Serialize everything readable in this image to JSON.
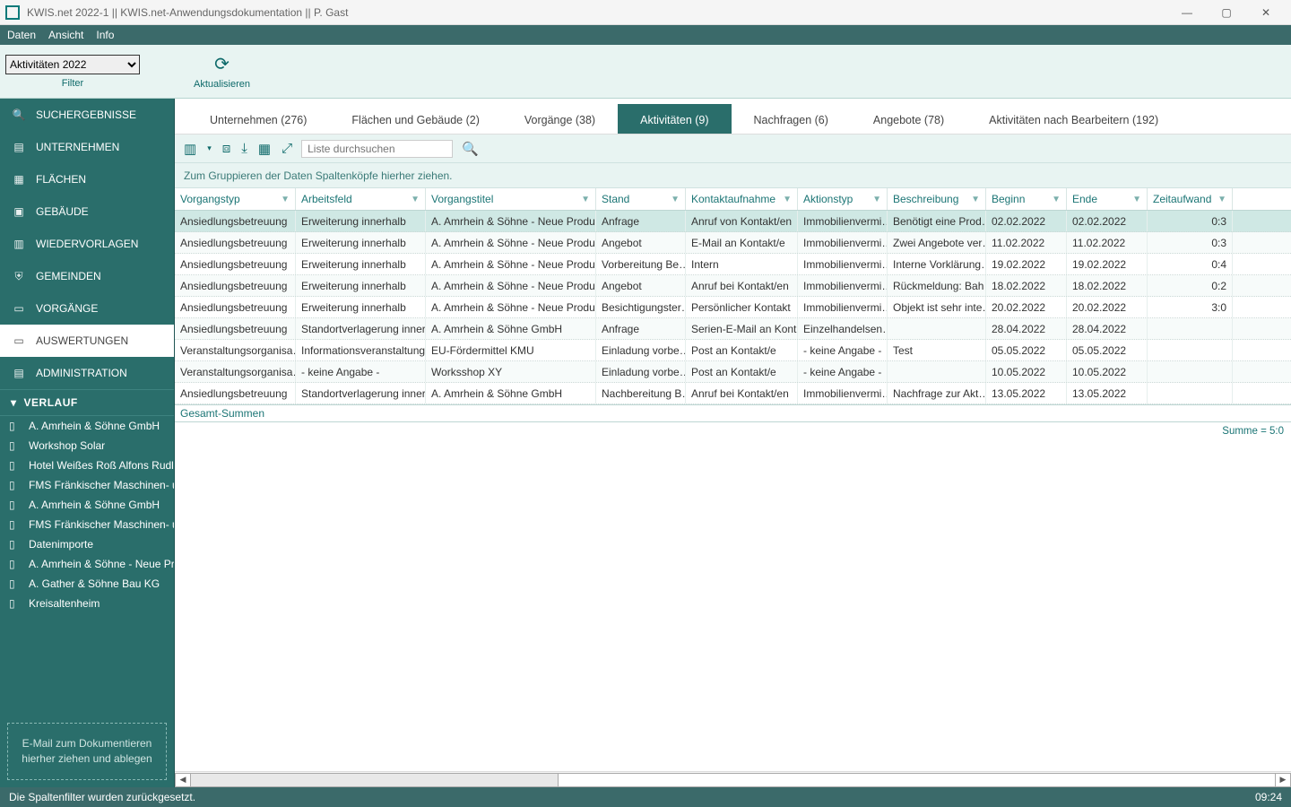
{
  "window": {
    "title": "KWIS.net 2022-1 || KWIS.net-Anwendungsdokumentation || P. Gast"
  },
  "menu": {
    "daten": "Daten",
    "ansicht": "Ansicht",
    "info": "Info"
  },
  "toolbar": {
    "filter_option": "Aktivitäten 2022",
    "filter": "Filter",
    "refresh": "Aktualisieren"
  },
  "sidebar": {
    "items": [
      {
        "label": "SUCHERGEBNISSE"
      },
      {
        "label": "UNTERNEHMEN"
      },
      {
        "label": "FLÄCHEN"
      },
      {
        "label": "GEBÄUDE"
      },
      {
        "label": "WIEDERVORLAGEN"
      },
      {
        "label": "GEMEINDEN"
      },
      {
        "label": "VORGÄNGE"
      },
      {
        "label": "AUSWERTUNGEN"
      },
      {
        "label": "ADMINISTRATION"
      }
    ],
    "history_header": "VERLAUF",
    "history": [
      "A. Amrhein & Söhne GmbH",
      "Workshop Solar",
      "Hotel Weißes Roß Alfons Rudl…",
      "FMS Fränkischer Maschinen- u…",
      "A. Amrhein & Söhne GmbH",
      "FMS Fränkischer Maschinen- u…",
      "Datenimporte",
      "A. Amrhein & Söhne - Neue Pr…",
      "A. Gather & Söhne Bau KG",
      "Kreisaltenheim"
    ],
    "dropzone": "E-Mail zum Dokumentieren hierher ziehen und ablegen"
  },
  "tabs": [
    {
      "label": "Unternehmen (276)"
    },
    {
      "label": "Flächen und Gebäude (2)"
    },
    {
      "label": "Vorgänge (38)"
    },
    {
      "label": "Aktivitäten (9)",
      "active": true
    },
    {
      "label": "Nachfragen (6)"
    },
    {
      "label": "Angebote (78)"
    },
    {
      "label": "Aktivitäten nach Bearbeitern (192)"
    }
  ],
  "search": {
    "placeholder": "Liste durchsuchen"
  },
  "groupbar": "Zum Gruppieren der Daten Spaltenköpfe hierher ziehen.",
  "columns": [
    "Vorgangstyp",
    "Arbeitsfeld",
    "Vorgangstitel",
    "Stand",
    "Kontaktaufnahme",
    "Aktionstyp",
    "Beschreibung",
    "Beginn",
    "Ende",
    "Zeitaufwand"
  ],
  "rows": [
    [
      "Ansiedlungsbetreuung",
      "Erweiterung innerhalb",
      "A. Amrhein & Söhne - Neue Produk…",
      "Anfrage",
      "Anruf von Kontakt/en",
      "Immobilienvermi…",
      "Benötigt eine Prod…",
      "02.02.2022",
      "02.02.2022",
      "0:3"
    ],
    [
      "Ansiedlungsbetreuung",
      "Erweiterung innerhalb",
      "A. Amrhein & Söhne - Neue Produk…",
      "Angebot",
      "E-Mail an Kontakt/e",
      "Immobilienvermi…",
      "Zwei Angebote ver…",
      "11.02.2022",
      "11.02.2022",
      "0:3"
    ],
    [
      "Ansiedlungsbetreuung",
      "Erweiterung innerhalb",
      "A. Amrhein & Söhne - Neue Produk…",
      "Vorbereitung Be…",
      "Intern",
      "Immobilienvermi…",
      "Interne Vorklärung…",
      "19.02.2022",
      "19.02.2022",
      "0:4"
    ],
    [
      "Ansiedlungsbetreuung",
      "Erweiterung innerhalb",
      "A. Amrhein & Söhne - Neue Produk…",
      "Angebot",
      "Anruf bei Kontakt/en",
      "Immobilienvermi…",
      "Rückmeldung: Bah…",
      "18.02.2022",
      "18.02.2022",
      "0:2"
    ],
    [
      "Ansiedlungsbetreuung",
      "Erweiterung innerhalb",
      "A. Amrhein & Söhne - Neue Produk…",
      "Besichtigungster…",
      "Persönlicher Kontakt",
      "Immobilienvermi…",
      "Objekt ist sehr inte…",
      "20.02.2022",
      "20.02.2022",
      "3:0"
    ],
    [
      "Ansiedlungsbetreuung",
      "Standortverlagerung inner…",
      "A. Amrhein & Söhne GmbH",
      "Anfrage",
      "Serien-E-Mail an Kont…",
      "Einzelhandelsen…",
      "",
      "28.04.2022",
      "28.04.2022",
      ""
    ],
    [
      "Veranstaltungsorganisa…",
      "Informationsveranstaltung",
      "EU-Fördermittel KMU",
      "Einladung vorbe…",
      "Post an Kontakt/e",
      "- keine Angabe -",
      "Test",
      "05.05.2022",
      "05.05.2022",
      ""
    ],
    [
      "Veranstaltungsorganisa…",
      "- keine Angabe -",
      "Worksshop XY",
      "Einladung vorbe…",
      "Post an Kontakt/e",
      "- keine Angabe -",
      "",
      "10.05.2022",
      "10.05.2022",
      ""
    ],
    [
      "Ansiedlungsbetreuung",
      "Standortverlagerung inner…",
      "A. Amrhein & Söhne GmbH",
      "Nachbereitung B…",
      "Anruf bei Kontakt/en",
      "Immobilienvermi…",
      "Nachfrage zur Akt…",
      "13.05.2022",
      "13.05.2022",
      ""
    ]
  ],
  "footer": {
    "gesamt": "Gesamt-Summen",
    "summe": "Summe = 5:0"
  },
  "status": {
    "msg": "Die Spaltenfilter wurden zurückgesetzt.",
    "time": "09:24"
  }
}
